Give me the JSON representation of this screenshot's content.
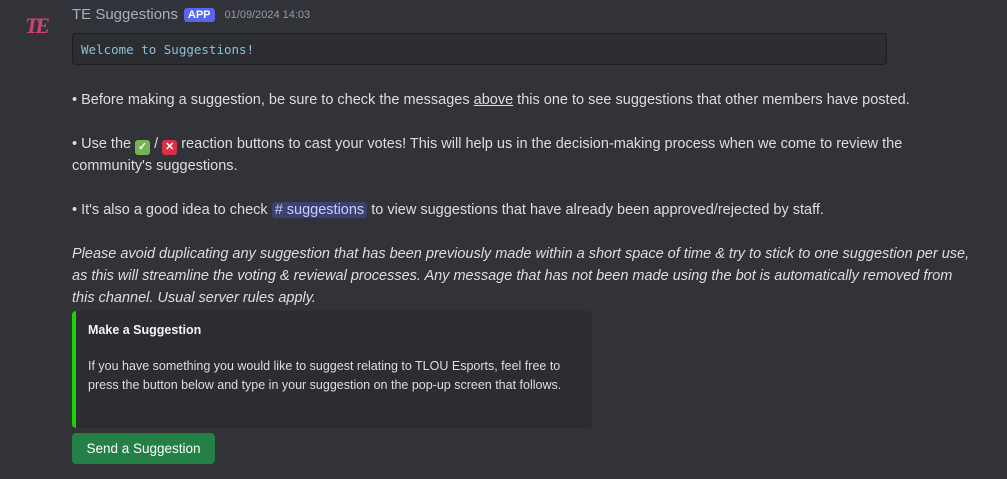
{
  "message": {
    "author": "TE Suggestions",
    "badge": "APP",
    "timestamp": "01/09/2024 14:03",
    "avatar_text": "TE",
    "codeblock": "Welcome to Suggestions!",
    "p1": {
      "before": "• Before making a suggestion, be sure to check the messages ",
      "link": "above",
      "after": " this one to see suggestions that other members have posted."
    },
    "p2": {
      "before": "• Use the ",
      "check_emoji": "✓",
      "separator": " / ",
      "cross_emoji": "✕",
      "after": " reaction buttons to cast your votes! This will help us in the decision-making process when we come to review the community's suggestions."
    },
    "p3": {
      "before": "• It's also a good idea to check ",
      "channel": "# suggestions",
      "after": " to view suggestions that have already been approved/rejected by staff."
    },
    "p4": "Please avoid duplicating any suggestion that has been previously made within a short space of time & try to stick to one suggestion per use, as this will streamline the voting & reviewal processes. Any message that has not been made using the bot is automatically removed from this channel. Usual server rules apply.",
    "embed": {
      "title": "Make a Suggestion",
      "description": "If you have something you would like to suggest relating to TLOU Esports, feel free to press the button below and type in your suggestion on the pop-up screen that follows.",
      "accent_color": "#16d600"
    },
    "button_label": "Send a Suggestion"
  },
  "colors": {
    "background": "#313338",
    "badge": "#5865f2",
    "button": "#248046",
    "mention": "#3c4270"
  }
}
